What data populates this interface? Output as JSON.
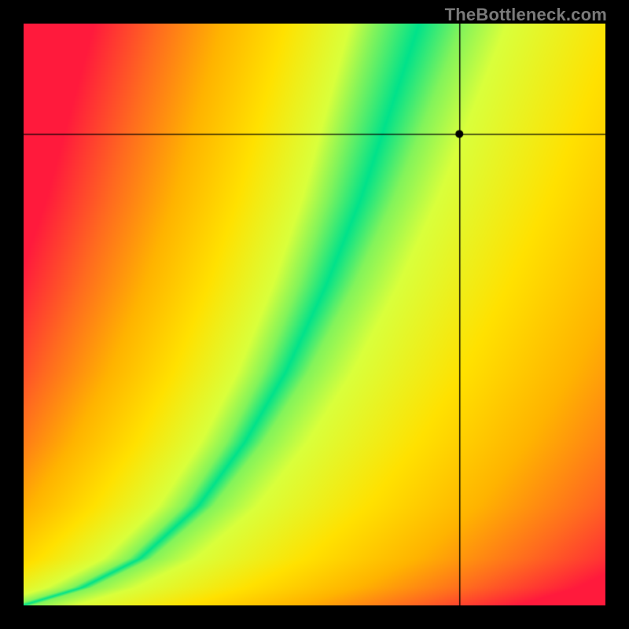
{
  "watermark": "TheBottleneck.com",
  "chart_data": {
    "type": "heatmap",
    "title": "",
    "xlabel": "",
    "ylabel": "",
    "xlim": [
      0,
      1
    ],
    "ylim": [
      0,
      1
    ],
    "grid": false,
    "marker": {
      "x": 0.75,
      "y": 0.81
    },
    "crosshair": {
      "x": 0.75,
      "y": 0.81
    },
    "optimal_curve_notes": "Green optimal band runs from bottom-left corner to top edge around x≈0.68; band widens toward the top. Colors transition red→orange→yellow→green with distance from band.",
    "optimal_curve_samples": [
      {
        "x": 0.0,
        "y": 0.0
      },
      {
        "x": 0.1,
        "y": 0.03
      },
      {
        "x": 0.2,
        "y": 0.08
      },
      {
        "x": 0.3,
        "y": 0.17
      },
      {
        "x": 0.38,
        "y": 0.28
      },
      {
        "x": 0.45,
        "y": 0.4
      },
      {
        "x": 0.52,
        "y": 0.55
      },
      {
        "x": 0.58,
        "y": 0.7
      },
      {
        "x": 0.63,
        "y": 0.85
      },
      {
        "x": 0.68,
        "y": 1.0
      }
    ],
    "color_scale": [
      "#ff1a3c",
      "#ff6a1f",
      "#ffb300",
      "#ffe100",
      "#d9ff3b",
      "#00e28a"
    ]
  }
}
